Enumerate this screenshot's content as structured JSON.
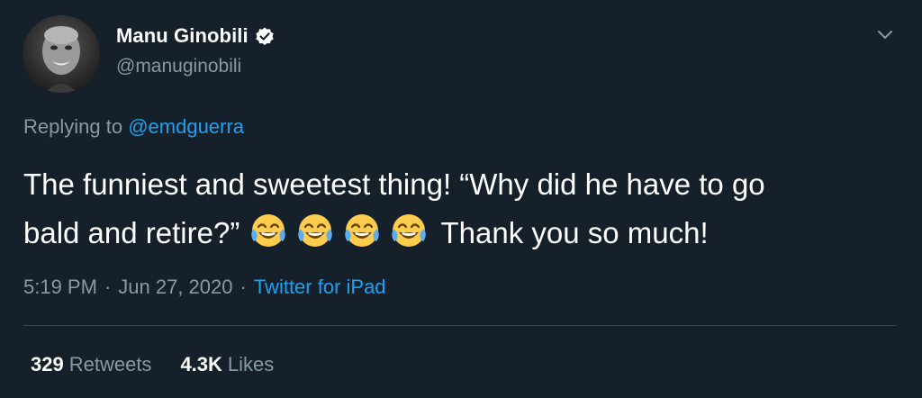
{
  "author": {
    "display_name": "Manu Ginobili",
    "handle": "@manuginobili",
    "verified": true
  },
  "reply": {
    "prefix": "Replying to",
    "mention": "@emdguerra"
  },
  "tweet": {
    "line1": "The funniest and sweetest thing! “Why did he have to go",
    "line2_start": "bald and retire?”",
    "emojis": [
      "face-with-tears-of-joy",
      "face-with-tears-of-joy",
      "face-with-tears-of-joy",
      "face-with-tears-of-joy"
    ],
    "line2_end": "Thank you so much!"
  },
  "meta": {
    "time": "5:19 PM",
    "separator": "·",
    "date": "Jun 27, 2020",
    "source": "Twitter for iPad"
  },
  "stats": {
    "retweets_count": "329",
    "retweets_label": "Retweets",
    "likes_count": "4.3K",
    "likes_label": "Likes"
  },
  "colors": {
    "background": "#15202b",
    "accent": "#1da1f2",
    "secondary_text": "#8899a6",
    "divider": "#38444d"
  }
}
